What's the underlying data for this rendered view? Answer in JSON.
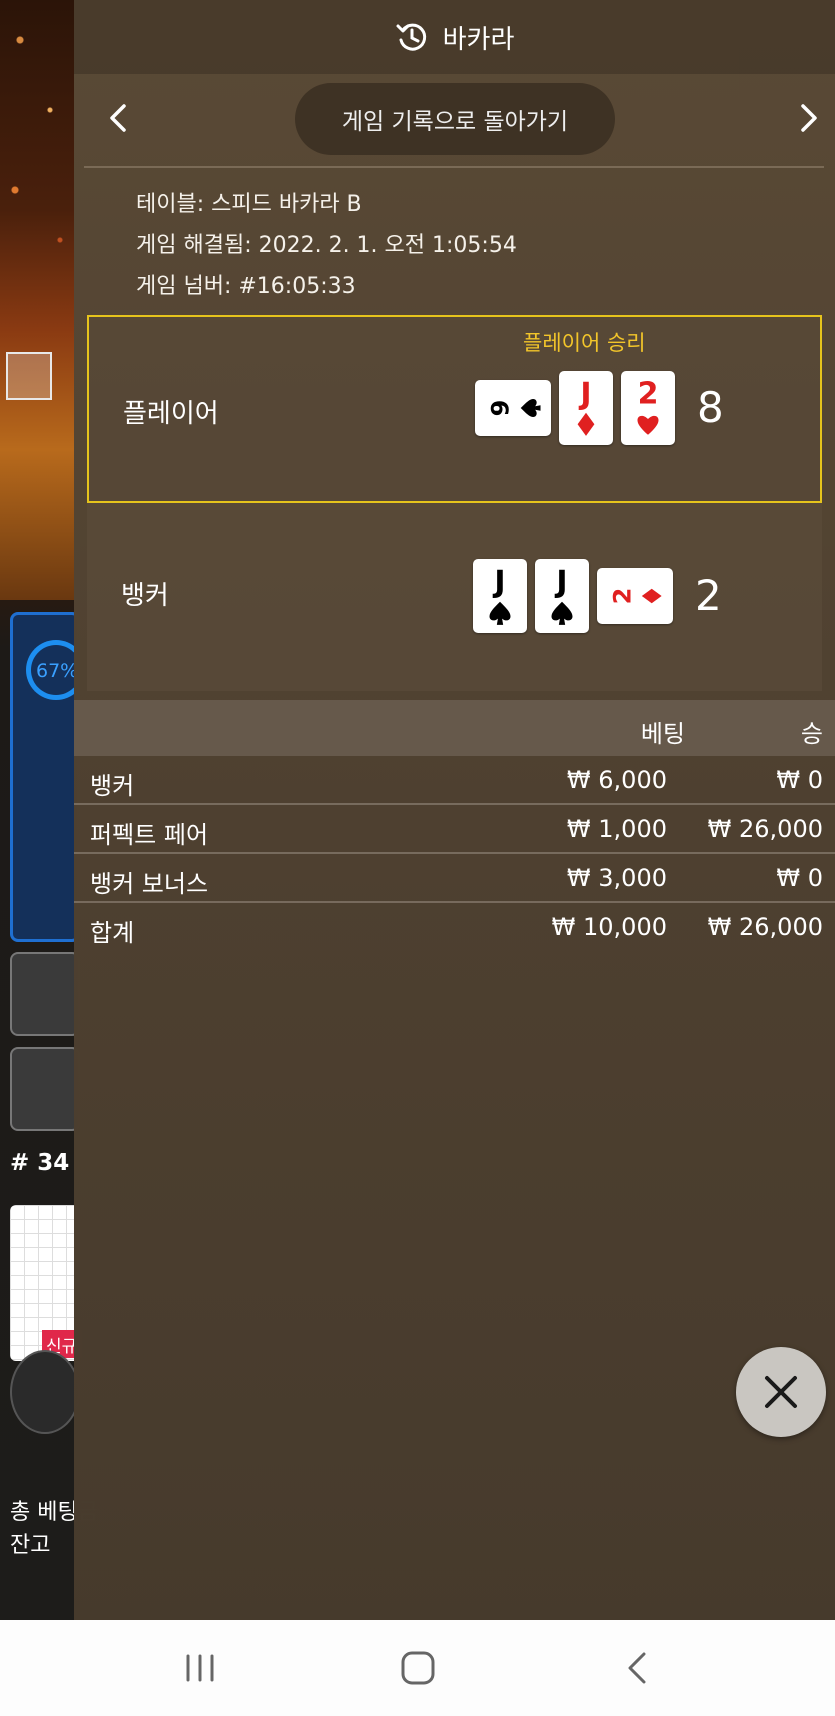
{
  "header": {
    "title": "바카라",
    "icon": "history-icon"
  },
  "nav": {
    "back_to_history": "게임 기록으로 돌아가기"
  },
  "info": {
    "table": "테이블: 스피드 바카라 B",
    "resolved": "게임 해결됨: 2022. 2. 1. 오전 1:05:54",
    "game_number": "게임 넘버: #16:05:33"
  },
  "player": {
    "label": "플레이어",
    "result": "플레이어 승리",
    "score": "8",
    "cards": [
      {
        "rank": "9",
        "suit": "spade",
        "side": true
      },
      {
        "rank": "J",
        "suit": "diamond",
        "side": false
      },
      {
        "rank": "2",
        "suit": "heart",
        "side": false
      }
    ]
  },
  "banker": {
    "label": "뱅커",
    "score": "2",
    "cards": [
      {
        "rank": "J",
        "suit": "spade",
        "side": false
      },
      {
        "rank": "J",
        "suit": "spade",
        "side": false
      },
      {
        "rank": "2",
        "suit": "diamond",
        "side": true
      }
    ]
  },
  "bets": {
    "header_bet": "베팅",
    "header_win": "승",
    "rows": [
      {
        "name": "뱅커",
        "bet": "₩ 6,000",
        "win": "₩ 0"
      },
      {
        "name": "퍼펙트 페어",
        "bet": "₩ 1,000",
        "win": "₩ 26,000"
      },
      {
        "name": "뱅커 보너스",
        "bet": "₩ 3,000",
        "win": "₩ 0"
      }
    ],
    "total": {
      "name": "합계",
      "bet": "₩ 10,000",
      "win": "₩ 26,000"
    }
  },
  "background": {
    "percent": "67%",
    "round": "# 34",
    "road_badge": "신규",
    "total_bet_label": "총 베팅금",
    "balance_label": "잔고"
  },
  "colors": {
    "win_gold": "#f2c52a",
    "player_border": "#e6c41c",
    "red_suit": "#e02020"
  },
  "icons": {
    "prev": "chevron-left-icon",
    "next": "chevron-right-icon",
    "close": "close-icon"
  }
}
